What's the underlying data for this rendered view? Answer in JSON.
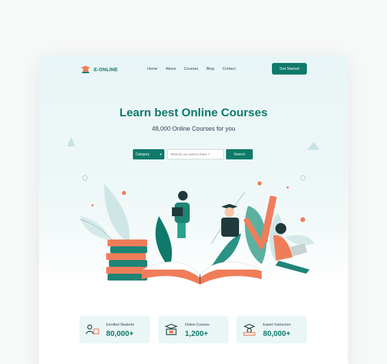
{
  "brand": {
    "name": "E-ONLINE"
  },
  "nav": {
    "items": [
      "Home",
      "About",
      "Courses",
      "Blog",
      "Contact"
    ]
  },
  "header": {
    "cta_label": "Get Started"
  },
  "hero": {
    "title": "Learn best Online Courses",
    "subtitle": "48,000 Online Courses for you"
  },
  "search": {
    "category_label": "Category",
    "placeholder": "What do you want to learn ?",
    "button_label": "Search"
  },
  "stats": [
    {
      "label": "Enrolled Students",
      "value": "80,000+",
      "icon": "students-icon"
    },
    {
      "label": "Online Courses",
      "value": "1,200+",
      "icon": "courses-icon"
    },
    {
      "label": "Expert Instructors",
      "value": "80,000+",
      "icon": "instructors-icon"
    }
  ],
  "colors": {
    "accent": "#0f7a6b",
    "orange": "#f07d5a",
    "hero_bg": "#e8f5f6"
  }
}
